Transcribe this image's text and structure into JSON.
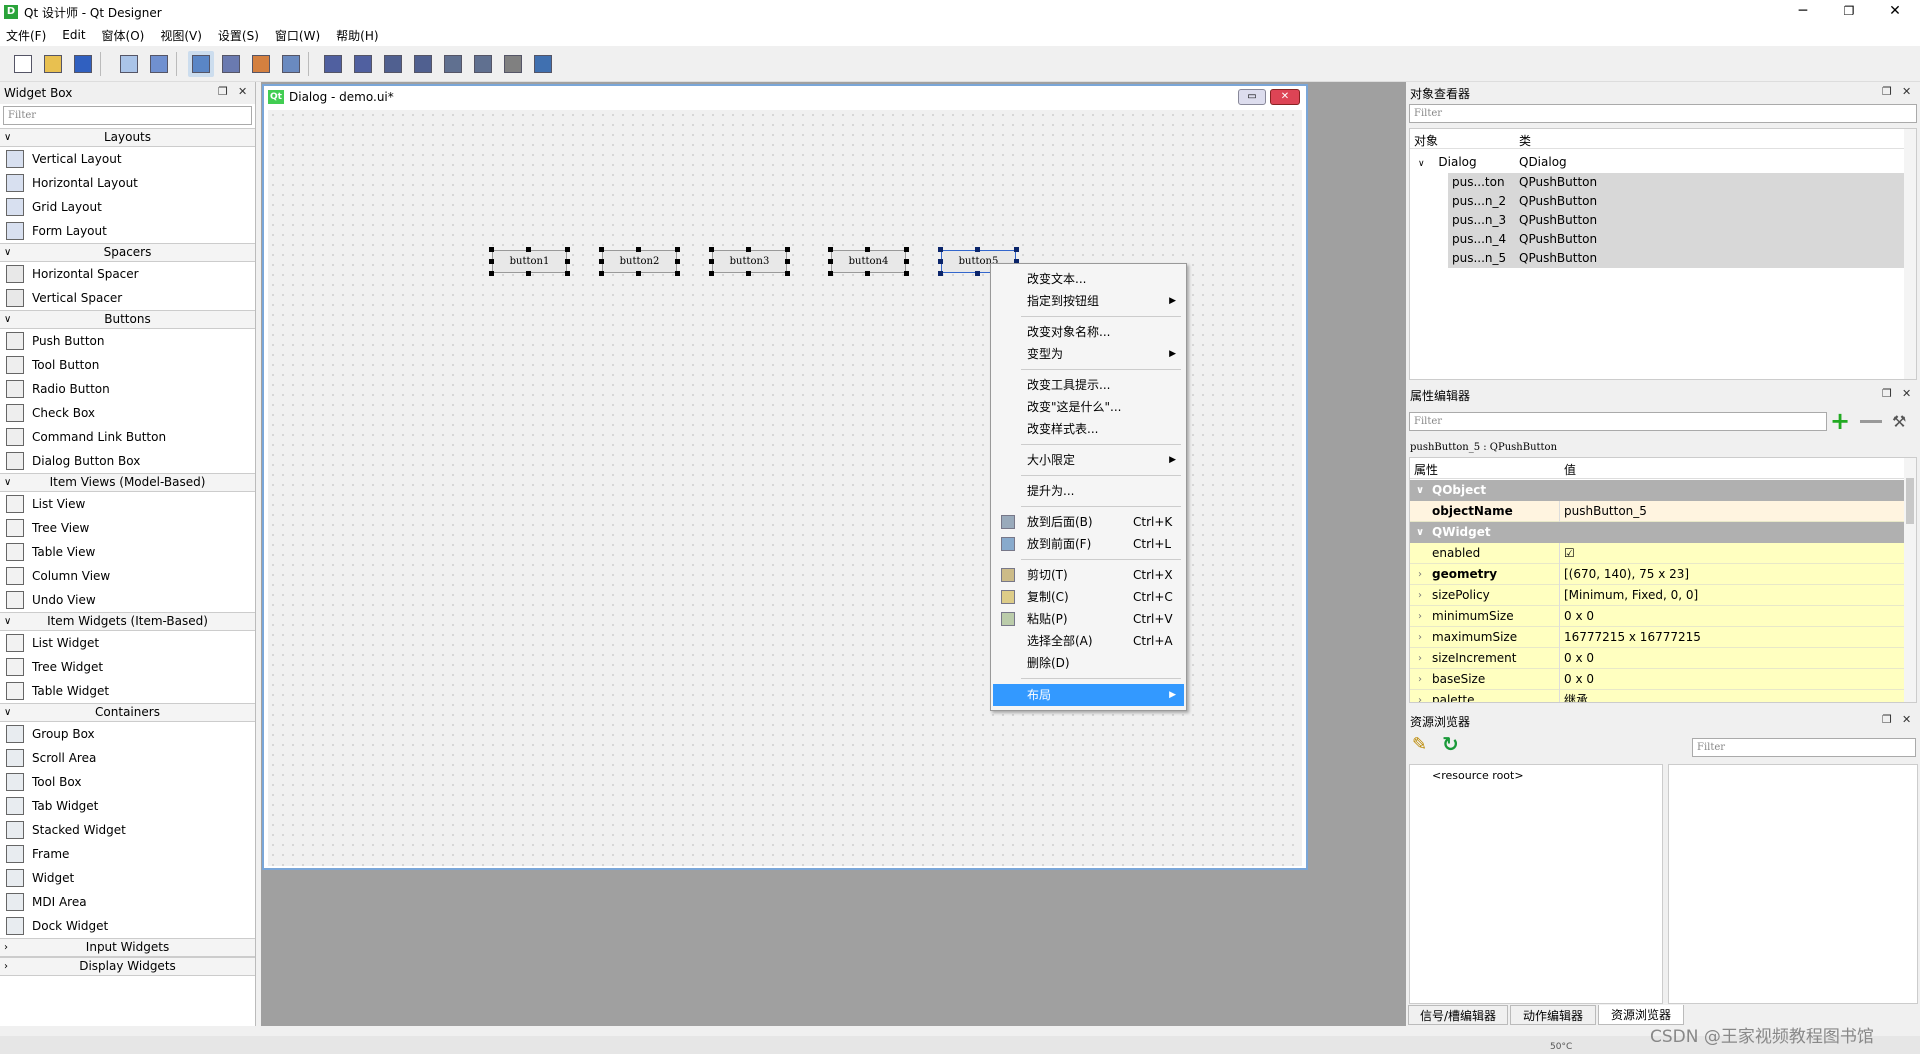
{
  "window": {
    "title": "Qt 设计师 - Qt Designer",
    "app_icon": "D",
    "controls": {
      "min": "─",
      "max": "❐",
      "close": "✕"
    }
  },
  "menu": [
    "文件(F)",
    "Edit",
    "窗体(O)",
    "视图(V)",
    "设置(S)",
    "窗口(W)",
    "帮助(H)"
  ],
  "toolbar_icons": [
    "new-file-icon",
    "open-file-icon",
    "save-icon",
    "send-to-back-icon",
    "bring-to-front-icon",
    "edit-widgets-icon",
    "edit-signals-slots-icon",
    "edit-buddies-icon",
    "edit-tab-order-icon",
    "layout-horizontal-icon",
    "layout-vertical-icon",
    "splitter-horizontal-icon",
    "splitter-vertical-icon",
    "layout-grid-icon",
    "layout-form-icon",
    "break-layout-icon",
    "adjust-size-icon"
  ],
  "widget_box": {
    "title": "Widget Box",
    "filter_placeholder": "Filter",
    "categories": [
      {
        "name": "Layouts",
        "items": [
          "Vertical Layout",
          "Horizontal Layout",
          "Grid Layout",
          "Form Layout"
        ]
      },
      {
        "name": "Spacers",
        "items": [
          "Horizontal Spacer",
          "Vertical Spacer"
        ]
      },
      {
        "name": "Buttons",
        "items": [
          "Push Button",
          "Tool Button",
          "Radio Button",
          "Check Box",
          "Command Link Button",
          "Dialog Button Box"
        ]
      },
      {
        "name": "Item Views (Model-Based)",
        "items": [
          "List View",
          "Tree View",
          "Table View",
          "Column View",
          "Undo View"
        ]
      },
      {
        "name": "Item Widgets (Item-Based)",
        "items": [
          "List Widget",
          "Tree Widget",
          "Table Widget"
        ]
      },
      {
        "name": "Containers",
        "items": [
          "Group Box",
          "Scroll Area",
          "Tool Box",
          "Tab Widget",
          "Stacked Widget",
          "Frame",
          "Widget",
          "MDI Area",
          "Dock Widget"
        ]
      },
      {
        "name": "Input Widgets",
        "items": []
      },
      {
        "name": "Display Widgets",
        "items": []
      }
    ]
  },
  "dialog": {
    "title": "Dialog - demo.ui*",
    "qt_logo": "Qt",
    "buttons": [
      "button1",
      "button2",
      "button3",
      "button4",
      "button5"
    ]
  },
  "context_menu": [
    {
      "label": "改变文本..."
    },
    {
      "label": "指定到按钮组",
      "submenu": true
    },
    {
      "sep": true
    },
    {
      "label": "改变对象名称..."
    },
    {
      "label": "变型为",
      "submenu": true
    },
    {
      "sep": true
    },
    {
      "label": "改变工具提示..."
    },
    {
      "label": "改变\"这是什么\"..."
    },
    {
      "label": "改变样式表..."
    },
    {
      "sep": true
    },
    {
      "label": "大小限定",
      "submenu": true
    },
    {
      "sep": true
    },
    {
      "label": "提升为..."
    },
    {
      "sep": true
    },
    {
      "label": "放到后面(B)",
      "shortcut": "Ctrl+K",
      "icon": "send-to-back-icon"
    },
    {
      "label": "放到前面(F)",
      "shortcut": "Ctrl+L",
      "icon": "bring-to-front-icon"
    },
    {
      "sep": true
    },
    {
      "label": "剪切(T)",
      "shortcut": "Ctrl+X",
      "icon": "cut-icon"
    },
    {
      "label": "复制(C)",
      "shortcut": "Ctrl+C",
      "icon": "copy-icon"
    },
    {
      "label": "粘贴(P)",
      "shortcut": "Ctrl+V",
      "icon": "paste-icon"
    },
    {
      "label": "选择全部(A)",
      "shortcut": "Ctrl+A"
    },
    {
      "label": "删除(D)"
    },
    {
      "sep": true
    },
    {
      "label": "布局",
      "submenu": true,
      "highlighted": true
    }
  ],
  "object_inspector": {
    "title": "对象查看器",
    "filter_placeholder": "Filter",
    "col_object": "对象",
    "col_class": "类",
    "root": {
      "name": "Dialog",
      "class": "QDialog"
    },
    "children": [
      {
        "name": "pus...ton",
        "class": "QPushButton"
      },
      {
        "name": "pus...n_2",
        "class": "QPushButton"
      },
      {
        "name": "pus...n_3",
        "class": "QPushButton"
      },
      {
        "name": "pus...n_4",
        "class": "QPushButton"
      },
      {
        "name": "pus...n_5",
        "class": "QPushButton"
      }
    ]
  },
  "property_editor": {
    "title": "属性编辑器",
    "filter_placeholder": "Filter",
    "selection": "pushButton_5 : QPushButton",
    "col_prop": "属性",
    "col_value": "值",
    "groups": [
      {
        "name": "QObject",
        "props": [
          {
            "name": "objectName",
            "value": "pushButton_5",
            "bold": true
          }
        ]
      },
      {
        "name": "QWidget",
        "props": [
          {
            "name": "enabled",
            "value": "☑"
          },
          {
            "name": "geometry",
            "value": "[(670, 140), 75 x 23]",
            "bold": true,
            "expand": true
          },
          {
            "name": "sizePolicy",
            "value": "[Minimum, Fixed, 0, 0]",
            "expand": true
          },
          {
            "name": "minimumSize",
            "value": "0 x 0",
            "expand": true
          },
          {
            "name": "maximumSize",
            "value": "16777215 x 16777215",
            "expand": true
          },
          {
            "name": "sizeIncrement",
            "value": "0 x 0",
            "expand": true
          },
          {
            "name": "baseSize",
            "value": "0 x 0",
            "expand": true
          },
          {
            "name": "palette",
            "value": "继承",
            "expand": true
          }
        ]
      }
    ]
  },
  "resource_browser": {
    "title": "资源浏览器",
    "filter_placeholder": "Filter",
    "root": "<resource root>"
  },
  "bottom_tabs": [
    "信号/槽编辑器",
    "动作编辑器",
    "资源浏览器"
  ],
  "watermark": "CSDN @王家视频教程图书馆",
  "temp": "50°C",
  "colors": {
    "accent": "#3399ff",
    "selection": "#c8daf4",
    "prop_row": "#ffffc0",
    "group_hdr": "#b0b0b0"
  }
}
